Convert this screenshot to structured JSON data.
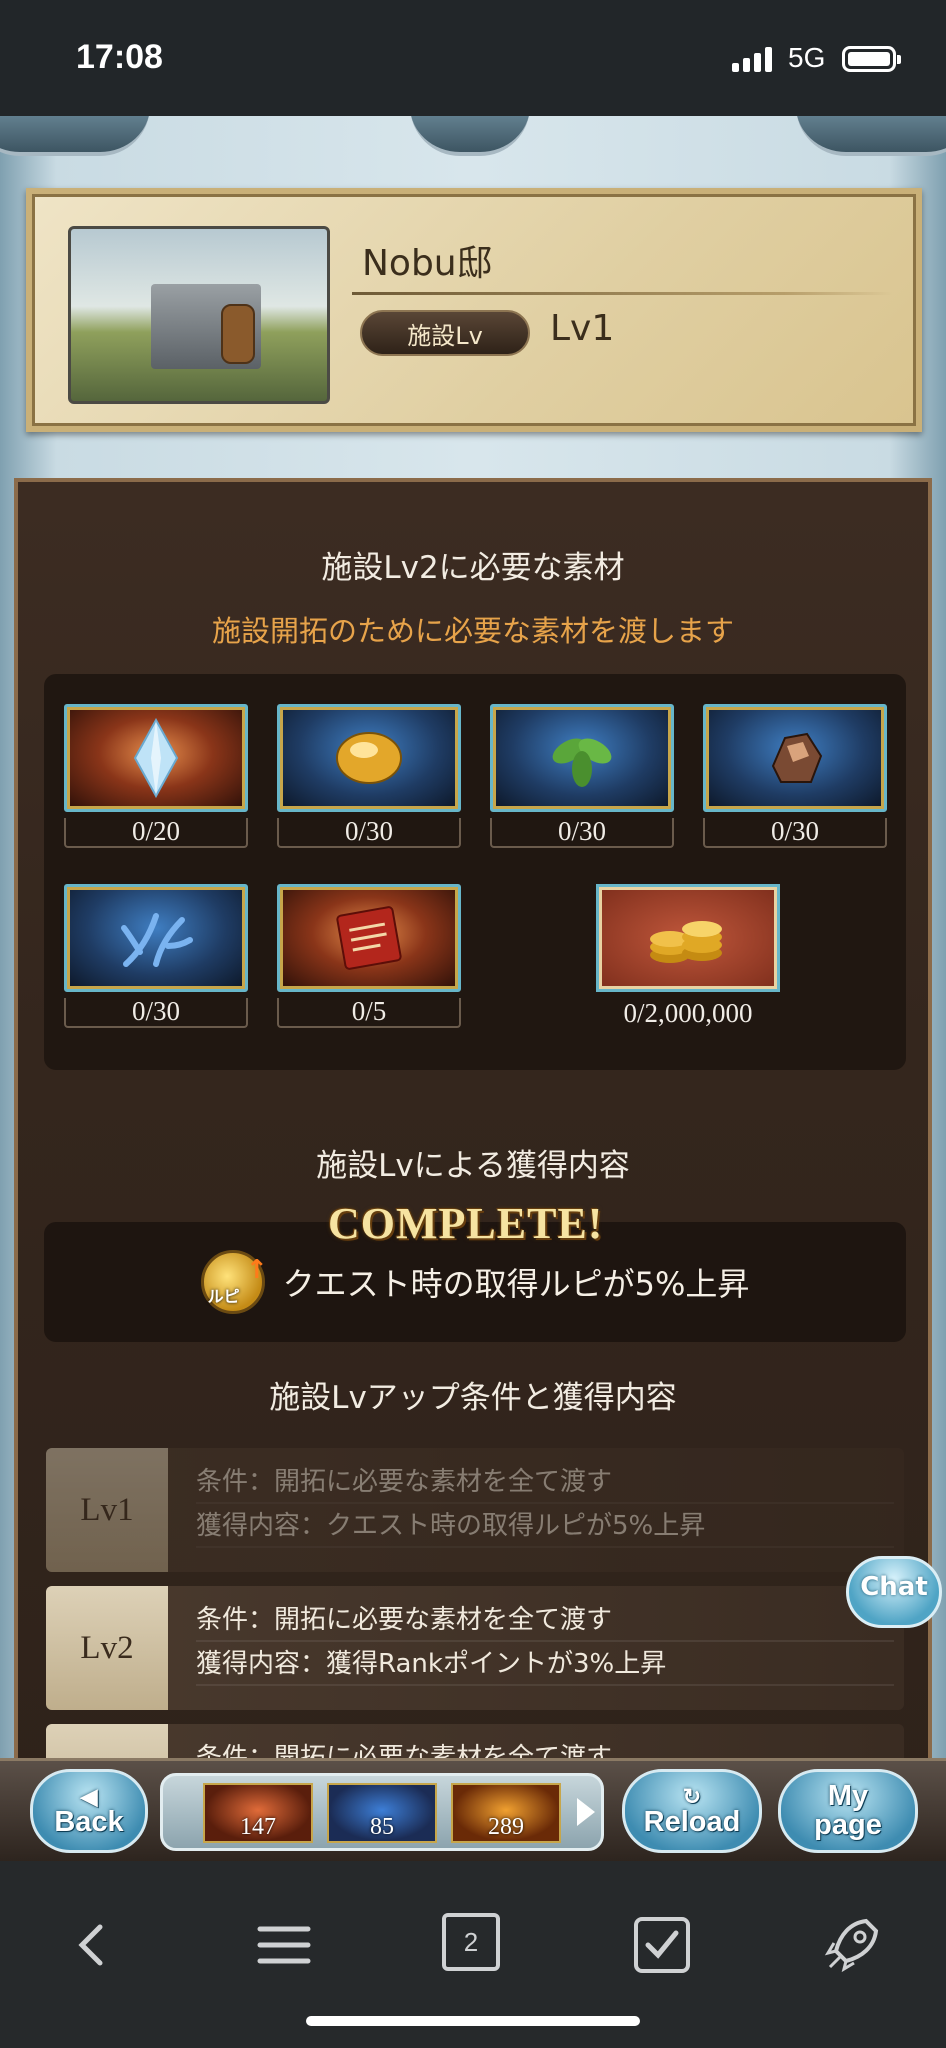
{
  "status_bar": {
    "time": "17:08",
    "network": "5G"
  },
  "facility": {
    "name": "Nobu邸",
    "lv_badge": "施設Lv",
    "lv_value": "Lv1"
  },
  "materials_section": {
    "title": "施設Lv2に必要な素材",
    "subtitle": "施設開拓のために必要な素材を渡します",
    "items": [
      {
        "icon": "crystal-icon",
        "count": "0/20"
      },
      {
        "icon": "gold-nugget-icon",
        "count": "0/30"
      },
      {
        "icon": "leaf-icon",
        "count": "0/30"
      },
      {
        "icon": "ore-icon",
        "count": "0/30"
      },
      {
        "icon": "coral-icon",
        "count": "0/30"
      },
      {
        "icon": "scroll-icon",
        "count": "0/5"
      }
    ],
    "rupie": {
      "icon": "rupie-coins-icon",
      "count": "0/2,000,000"
    }
  },
  "bonus_section": {
    "title": "施設Lvによる獲得内容",
    "icon_label": "ルピ",
    "text": "クエスト時の取得ルピが5%上昇"
  },
  "levelup_section": {
    "title": "施設Lvアップ条件と獲得内容",
    "complete_label": "COMPLETE!",
    "rows": [
      {
        "level": "Lv1",
        "condition": "条件：開拓に必要な素材を全て渡す",
        "reward": "獲得内容：クエスト時の取得ルピが5%上昇"
      },
      {
        "level": "Lv2",
        "condition": "条件：開拓に必要な素材を全て渡す",
        "reward": "獲得内容：獲得Rankポイントが3%上昇"
      },
      {
        "level": "",
        "condition": "条件：開拓に必要な素材を全て渡す",
        "reward": ""
      }
    ]
  },
  "chat_button": "Chat",
  "game_bar": {
    "back": "Back",
    "reload": "Reload",
    "mypage_top": "My",
    "mypage_bottom": "page",
    "items": [
      "147",
      "85",
      "289"
    ]
  },
  "browser": {
    "tab_count": "2"
  }
}
